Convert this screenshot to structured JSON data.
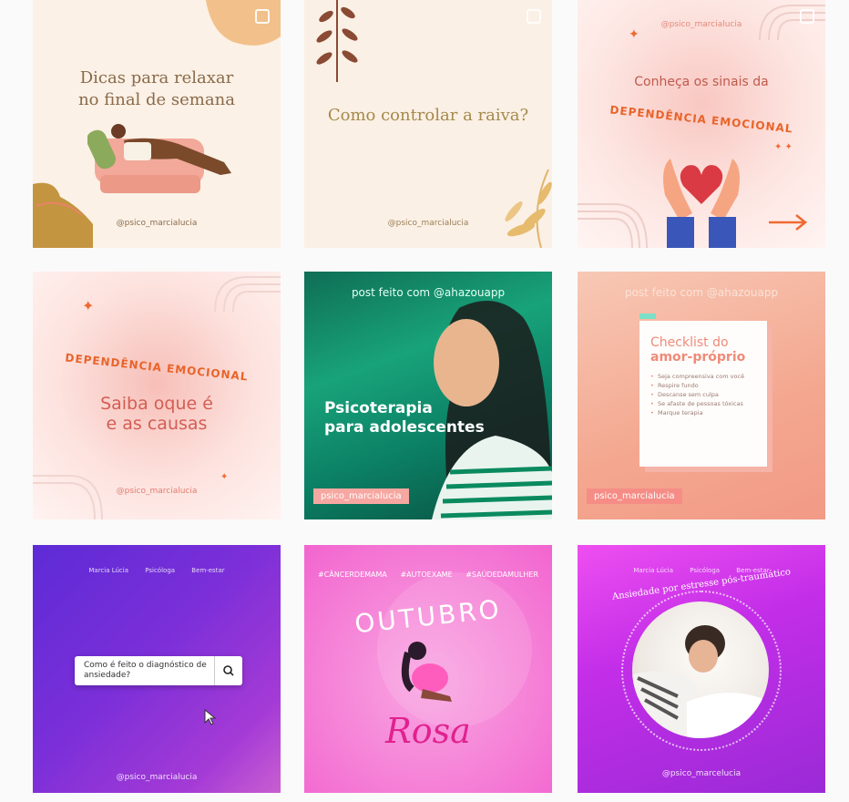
{
  "posts": [
    {
      "title": "Dicas para relaxar no final de semana",
      "handle": "@psico_marcialucia"
    },
    {
      "title": "Como controlar a raiva?",
      "handle": "@psico_marcialucia"
    },
    {
      "handle_top": "@psico_marcialucia",
      "heading": "Conheça os sinais da",
      "arc": "DEPENDÊNCIA EMOCIONAL"
    },
    {
      "arc": "DEPENDÊNCIA EMOCIONAL",
      "line1": "Saiba oque é",
      "line2": "e as causas",
      "handle": "@psico_marcialucia"
    },
    {
      "top": "post feito com @ahazouapp",
      "line1": "Psicoterapia",
      "line2": "para adolescentes",
      "tag": "psico_marcialucia"
    },
    {
      "top": "post feito com @ahazouapp",
      "title1": "Checklist do",
      "title2": "amor-próprio",
      "items": [
        "Seja compreensiva com você",
        "Respire fundo",
        "Descanse sem culpa",
        "Se afaste de pessoas tóxicas",
        "Marque terapia"
      ],
      "tag": "psico_marcialucia"
    },
    {
      "tags": [
        "Marcia Lúcia",
        "Psicóloga",
        "Bem-estar"
      ],
      "question": "Como é feito o diagnóstico de ansiedade?",
      "handle": "@psico_marcialucia"
    },
    {
      "tags": [
        "#CÂNCERDEMAMA",
        "#AUTOEXAME",
        "#SAÚDEDAMULHER"
      ],
      "month": "OUTUBRO",
      "word": "Rosa"
    },
    {
      "tags": [
        "Marcia Lúcia",
        "Psicóloga",
        "Bem-estar"
      ],
      "arc": "Ansiedade por estresse pós-traumático",
      "handle": "@psico_marcelucia"
    }
  ]
}
